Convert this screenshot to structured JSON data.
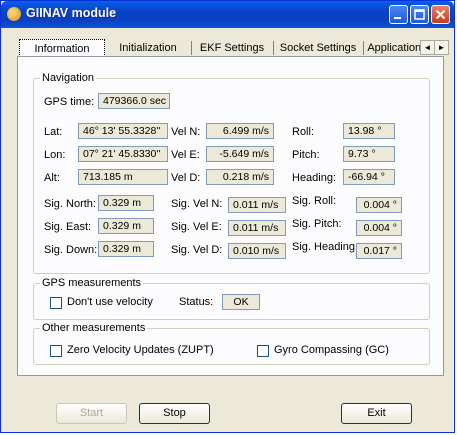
{
  "window": {
    "title": "GIINAV module"
  },
  "tabs": [
    "Information",
    "Initialization",
    "EKF Settings",
    "Socket Settings",
    "Applications"
  ],
  "tab_scroll": {
    "left": "◄",
    "right": "►"
  },
  "navigation": {
    "group_label": "Navigation",
    "gps_time": {
      "label": "GPS time:",
      "value": "479366.0 sec"
    },
    "lat": {
      "label": "Lat:",
      "value": "46° 13' 55.3328''"
    },
    "lon": {
      "label": "Lon:",
      "value": "07° 21' 45.8330''"
    },
    "alt": {
      "label": "Alt:",
      "value": "713.185 m"
    },
    "vel_n": {
      "label": "Vel N:",
      "value": "6.499 m/s"
    },
    "vel_e": {
      "label": "Vel E:",
      "value": "-5.649 m/s"
    },
    "vel_d": {
      "label": "Vel D:",
      "value": "0.218 m/s"
    },
    "roll": {
      "label": "Roll:",
      "value": "13.98 °"
    },
    "pitch": {
      "label": "Pitch:",
      "value": "9.73 °"
    },
    "heading": {
      "label": "Heading:",
      "value": "-66.94 °"
    },
    "sig_north": {
      "label": "Sig. North:",
      "value": "0.329 m"
    },
    "sig_east": {
      "label": "Sig. East:",
      "value": "0.329 m"
    },
    "sig_down": {
      "label": "Sig. Down:",
      "value": "0.329 m"
    },
    "sig_vel_n": {
      "label": "Sig. Vel N:",
      "value": "0.011 m/s"
    },
    "sig_vel_e": {
      "label": "Sig. Vel E:",
      "value": "0.011 m/s"
    },
    "sig_vel_d": {
      "label": "Sig. Vel D:",
      "value": "0.010 m/s"
    },
    "sig_roll": {
      "label": "Sig. Roll:",
      "value": "0.004 °"
    },
    "sig_pitch": {
      "label": "Sig. Pitch:",
      "value": "0.004 °"
    },
    "sig_heading": {
      "label": "Sig. Heading:",
      "value": "0.017 °"
    }
  },
  "gps_measurements": {
    "group_label": "GPS measurements",
    "dont_use_velocity": "Don't use velocity",
    "status_label": "Status:",
    "status_value": "OK"
  },
  "other_measurements": {
    "group_label": "Other measurements",
    "zupt": "Zero Velocity Updates (ZUPT)",
    "gyro": "Gyro Compassing (GC)"
  },
  "buttons": {
    "start": "Start",
    "stop": "Stop",
    "exit": "Exit"
  },
  "colors": {
    "titlebar": "#0842c8",
    "window_bg": "#ece9d8",
    "pane_bg": "#fcfcfe"
  }
}
